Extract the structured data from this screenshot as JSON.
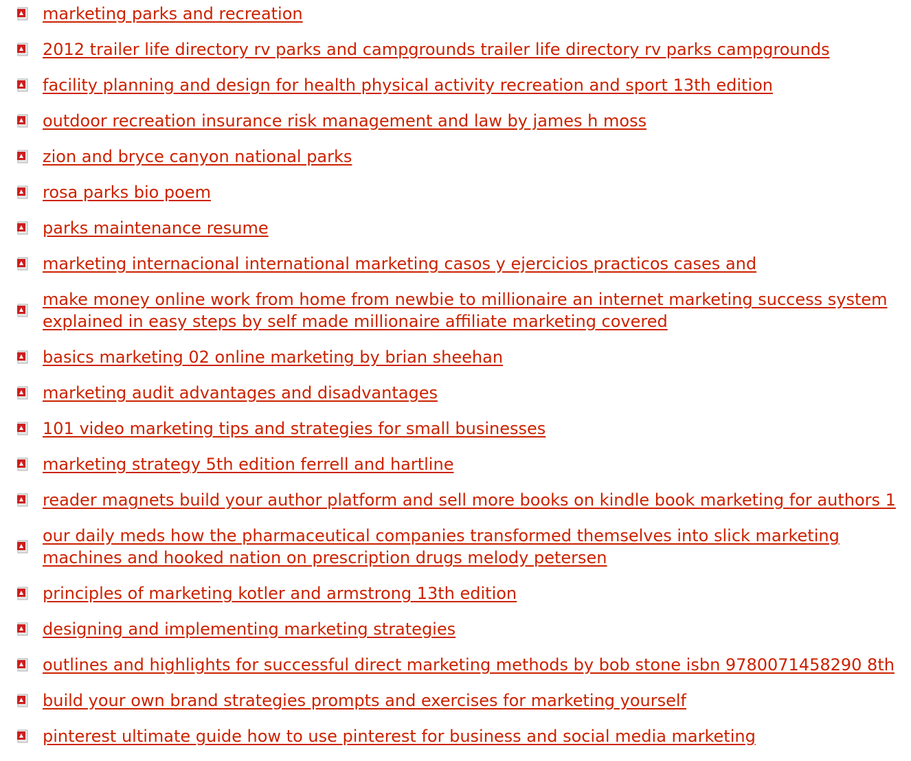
{
  "icons": {
    "file_icon_name": "pdf-icon",
    "icon_color": "#cc2200"
  },
  "links": [
    {
      "text": "marketing parks and recreation"
    },
    {
      "text": "2012 trailer life directory rv parks and campgrounds trailer life directory rv parks campgrounds"
    },
    {
      "text": "facility planning and design for health physical activity recreation and sport 13th edition"
    },
    {
      "text": "outdoor recreation insurance risk management and law by james h moss"
    },
    {
      "text": "zion and bryce canyon national parks"
    },
    {
      "text": "rosa parks bio poem"
    },
    {
      "text": "parks maintenance resume"
    },
    {
      "text": "marketing internacional international marketing casos y ejercicios practicos cases and"
    },
    {
      "text": "make money online work from home from newbie to millionaire an internet marketing success system explained in easy steps by self made millionaire affiliate marketing covered"
    },
    {
      "text": "basics marketing 02 online marketing by brian sheehan"
    },
    {
      "text": "marketing audit advantages and disadvantages"
    },
    {
      "text": "101 video marketing tips and strategies for small businesses"
    },
    {
      "text": "marketing strategy 5th edition ferrell and hartline"
    },
    {
      "text": "reader magnets build your author platform and sell more books on kindle book marketing for authors 1"
    },
    {
      "text": "our daily meds how the pharmaceutical companies transformed themselves into slick marketing machines and hooked nation on prescription drugs melody petersen"
    },
    {
      "text": "principles of marketing kotler and armstrong 13th edition"
    },
    {
      "text": "designing and implementing marketing strategies"
    },
    {
      "text": "outlines and highlights for successful direct marketing methods by bob stone isbn 9780071458290 8th"
    },
    {
      "text": "build your own brand strategies prompts and exercises for marketing yourself"
    },
    {
      "text": "pinterest ultimate guide how to use pinterest for business and social media marketing"
    }
  ]
}
